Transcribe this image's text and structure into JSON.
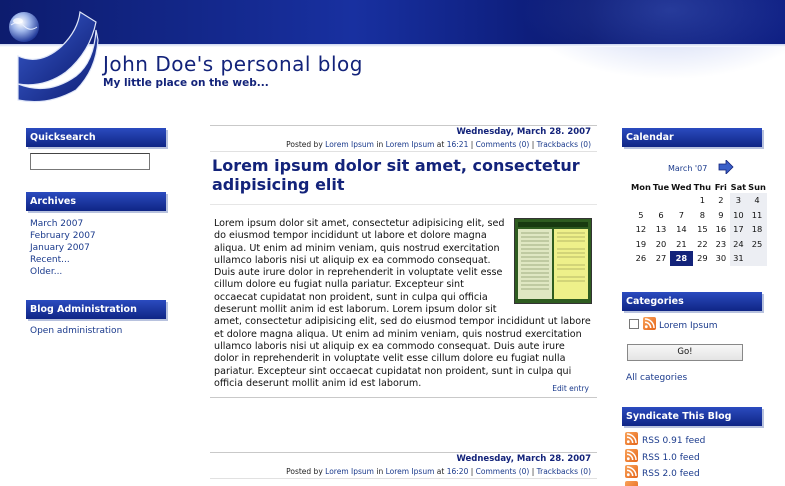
{
  "header": {
    "title": "John Doe's personal blog",
    "subtitle": "My little place on the web..."
  },
  "sidebar_left": {
    "quicksearch": {
      "heading": "Quicksearch",
      "value": ""
    },
    "archives": {
      "heading": "Archives",
      "items": [
        "March 2007",
        "February 2007",
        "January 2007",
        "Recent...",
        "Older..."
      ]
    },
    "admin": {
      "heading": "Blog Administration",
      "link": "Open administration"
    }
  },
  "entries": [
    {
      "date": "Wednesday, March 28. 2007",
      "posted_by_prefix": "Posted by",
      "author": "Lorem Ipsum",
      "in_word": "in",
      "category": "Lorem Ipsum",
      "at_word": "at",
      "time": "16:21",
      "comments": "Comments (0)",
      "trackbacks": "Trackbacks (0)",
      "title": "Lorem ipsum dolor sit amet, consectetur adipisicing elit",
      "body": "Lorem ipsum dolor sit amet, consectetur adipisicing elit, sed do eiusmod tempor incididunt ut labore et dolore magna aliqua. Ut enim ad minim veniam, quis nostrud exercitation ullamco laboris nisi ut aliquip ex ea commodo consequat. Duis aute irure dolor in reprehenderit in voluptate velit esse cillum dolore eu fugiat nulla pariatur. Excepteur sint occaecat cupidatat non proident, sunt in culpa qui officia deserunt mollit anim id est laborum. Lorem ipsum dolor sit amet, consectetur adipisicing elit, sed do eiusmod tempor incididunt ut labore et dolore magna aliqua. Ut enim ad minim veniam, quis nostrud exercitation ullamco laboris nisi ut aliquip ex ea commodo consequat. Duis aute irure dolor in reprehenderit in voluptate velit esse cillum dolore eu fugiat nulla pariatur. Excepteur sint occaecat cupidatat non proident, sunt in culpa qui officia deserunt mollit anim id est laborum.",
      "edit": "Edit entry"
    },
    {
      "date": "Wednesday, March 28. 2007",
      "posted_by_prefix": "Posted by",
      "author": "Lorem Ipsum",
      "in_word": "in",
      "category": "Lorem Ipsum",
      "at_word": "at",
      "time": "16:20",
      "comments": "Comments (0)",
      "trackbacks": "Trackbacks (0)"
    }
  ],
  "sidebar_right": {
    "calendar": {
      "heading": "Calendar",
      "month": "March '07",
      "days": [
        "Mon",
        "Tue",
        "Wed",
        "Thu",
        "Fri",
        "Sat",
        "Sun"
      ],
      "weeks": [
        [
          "",
          "",
          "",
          "1",
          "2",
          "3",
          "4"
        ],
        [
          "5",
          "6",
          "7",
          "8",
          "9",
          "10",
          "11"
        ],
        [
          "12",
          "13",
          "14",
          "15",
          "16",
          "17",
          "18"
        ],
        [
          "19",
          "20",
          "21",
          "22",
          "23",
          "24",
          "25"
        ],
        [
          "26",
          "27",
          "28",
          "29",
          "30",
          "31",
          ""
        ]
      ],
      "today": "28"
    },
    "categories": {
      "heading": "Categories",
      "items": [
        "Lorem Ipsum"
      ],
      "go": "Go!",
      "all": "All categories"
    },
    "syndicate": {
      "heading": "Syndicate This Blog",
      "feeds": [
        "RSS 0.91 feed",
        "RSS 1.0 feed",
        "RSS 2.0 feed"
      ]
    }
  },
  "colors": {
    "banner": "#0d1c6e",
    "heading": "#13237a",
    "link": "#1a3a8c",
    "rss": "#e5661a"
  }
}
